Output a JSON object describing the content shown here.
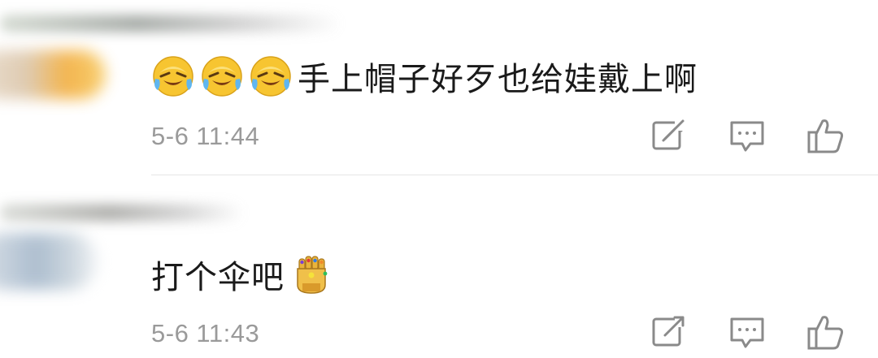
{
  "comments": [
    {
      "text": "手上帽子好歹也给娃戴上啊",
      "emojis": [
        "laugh-cry-emoji",
        "laugh-cry-emoji",
        "laugh-cry-emoji"
      ],
      "timestamp": "5-6 11:44",
      "actions": [
        "share-icon",
        "reply-icon",
        "like-icon"
      ]
    },
    {
      "text": "打个伞吧",
      "emojis": [
        "infinity-gauntlet-emoji"
      ],
      "timestamp": "5-6 11:43",
      "actions": [
        "share-icon",
        "reply-icon",
        "like-icon"
      ]
    }
  ],
  "colors": {
    "text": "#1a1a1a",
    "meta": "#9a9a9a",
    "icon": "#8a8a8a",
    "divider": "#e6e6e6",
    "emoji_yellow": "#f7c531"
  }
}
